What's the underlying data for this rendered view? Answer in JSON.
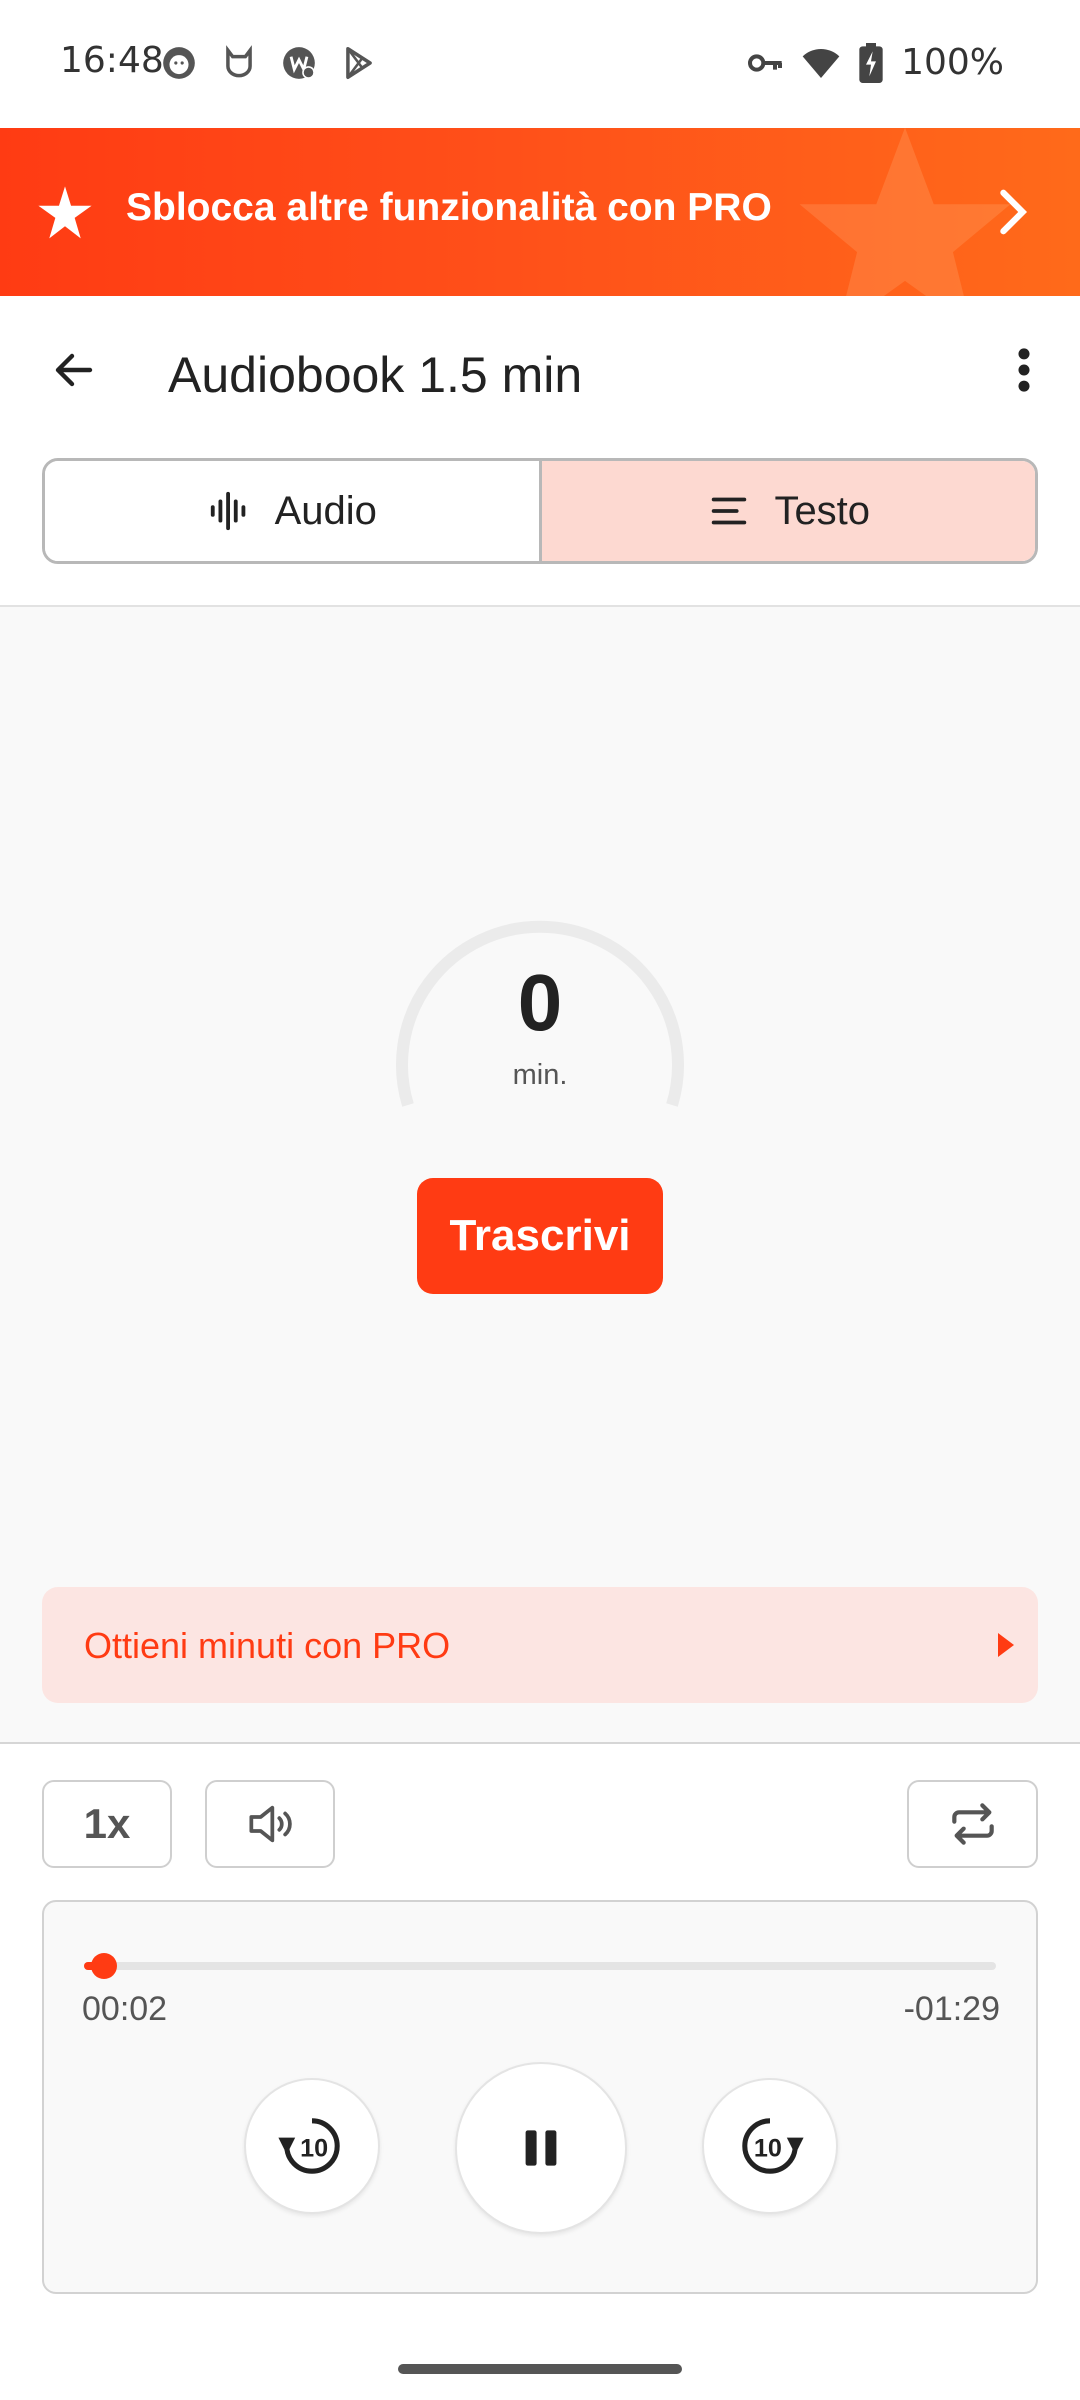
{
  "status_bar": {
    "time": "16:48",
    "battery": "100%",
    "icons_left": [
      "face-notification-icon",
      "cat-notification-icon",
      "app-badge-icon",
      "play-store-icon"
    ],
    "icons_right": [
      "vpn-key-icon",
      "wifi-icon",
      "battery-charging-icon"
    ]
  },
  "promo": {
    "text": "Sblocca altre funzionalità con PRO",
    "colors": {
      "start": "#ff3b13",
      "end": "#ff6a1a"
    }
  },
  "app_bar": {
    "title": "Audiobook 1.5 min"
  },
  "tabs": [
    {
      "label": "Audio",
      "icon": "waveform-icon",
      "active": false
    },
    {
      "label": "Testo",
      "icon": "text-lines-icon",
      "active": true
    }
  ],
  "transcription": {
    "minutes_value": "0",
    "minutes_unit": "min.",
    "button_label": "Trascrivi"
  },
  "pro_bar": {
    "text": "Ottieni minuti con PRO"
  },
  "player": {
    "speed_label": "1x",
    "elapsed": "00:02",
    "remaining": "-01:29",
    "progress": 0.022,
    "skip_seconds": "10",
    "state": "playing"
  },
  "colors": {
    "accent": "#ff3b13",
    "tab_active_bg": "#fdd9d1",
    "pro_bar_bg": "#fce5e2"
  }
}
